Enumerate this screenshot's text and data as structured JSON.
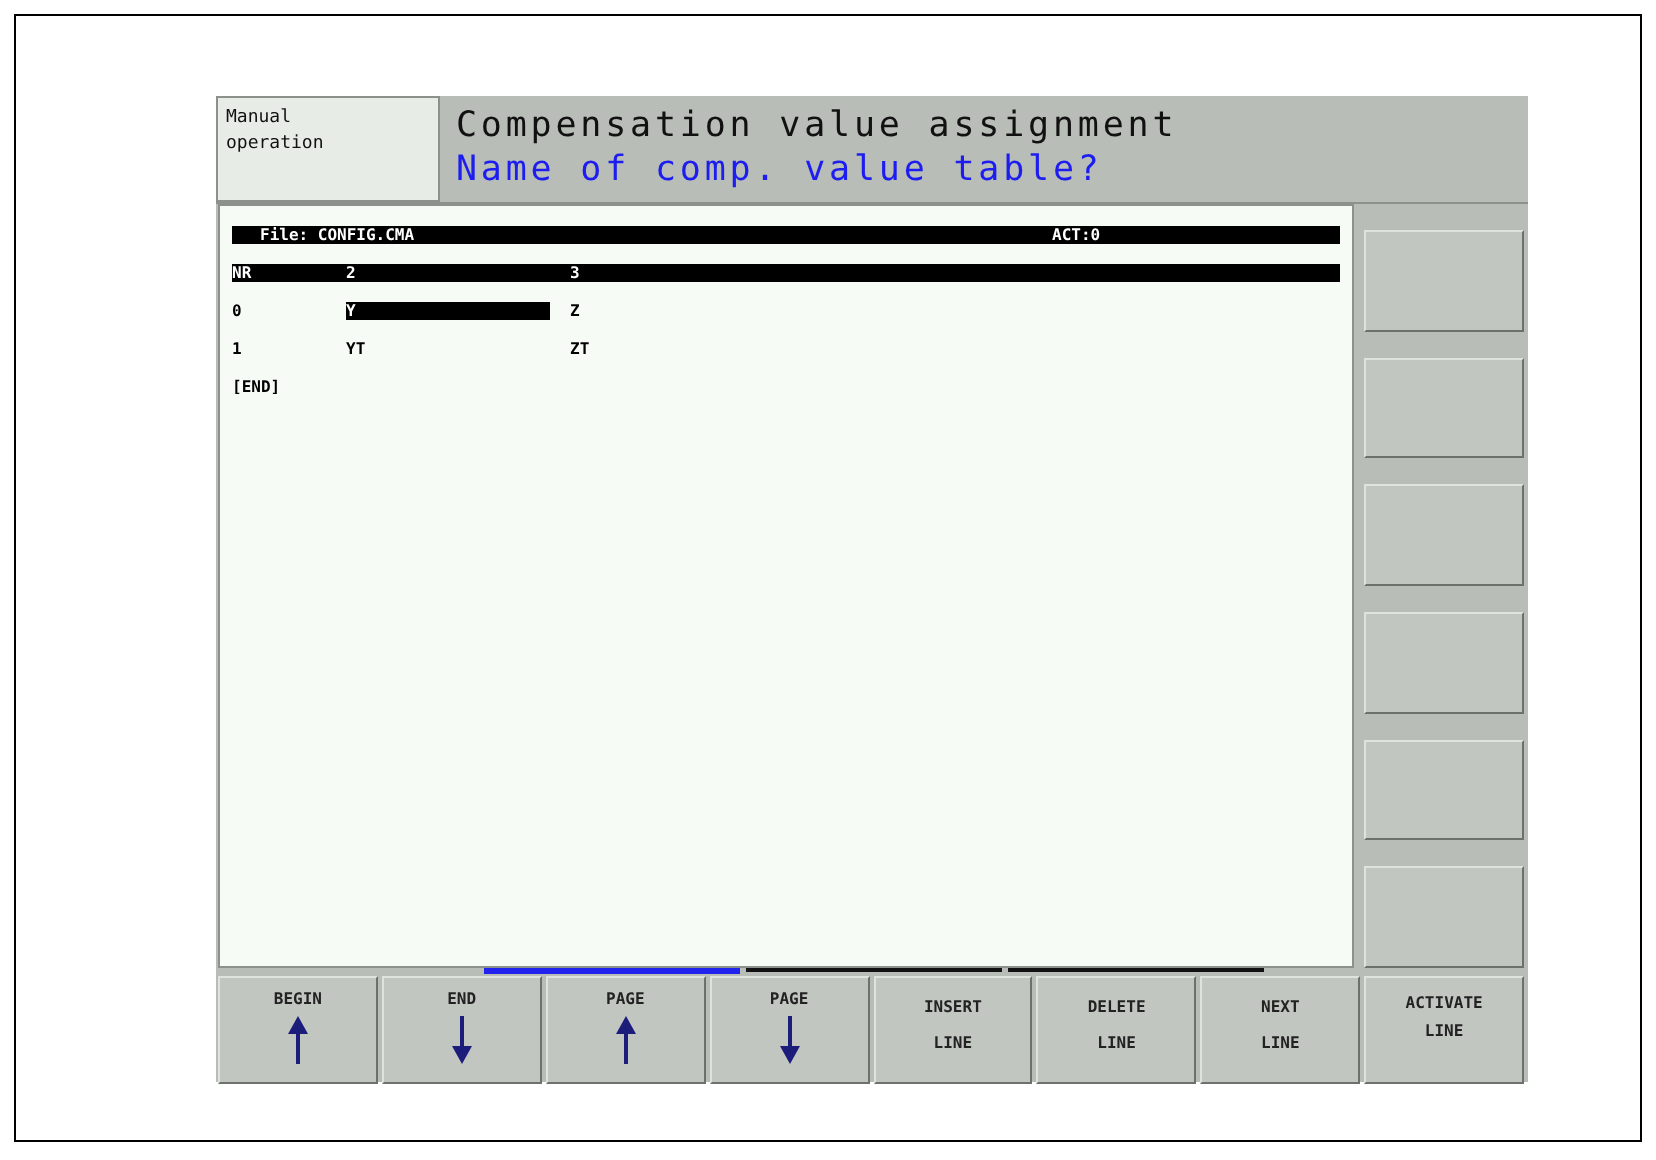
{
  "mode": {
    "label": "Manual\noperation"
  },
  "header": {
    "title": "Compensation value assignment",
    "prompt": "Name of comp. value table?"
  },
  "table": {
    "file": "File: CONFIG.CMA",
    "act": "ACT:0",
    "columns": [
      "NR",
      "2",
      "3"
    ],
    "rows": [
      {
        "cells": [
          {
            "text": "0",
            "selected": false
          },
          {
            "text": "Y",
            "selected": true
          },
          {
            "text": "Z",
            "selected": false
          }
        ]
      },
      {
        "cells": [
          {
            "text": "1",
            "selected": false
          },
          {
            "text": "YT",
            "selected": false
          },
          {
            "text": "ZT",
            "selected": false
          }
        ]
      }
    ],
    "end_marker": "[END]"
  },
  "softkey_levels": [
    {
      "selected": true
    },
    {
      "selected": false
    },
    {
      "selected": false
    }
  ],
  "softkeys": [
    {
      "label": "BEGIN",
      "kind": "up"
    },
    {
      "label": "END",
      "kind": "down"
    },
    {
      "label": "PAGE",
      "kind": "up"
    },
    {
      "label": "PAGE",
      "kind": "down"
    },
    {
      "label": "INSERT\nLINE",
      "kind": "text"
    },
    {
      "label": "DELETE\nLINE",
      "kind": "text"
    },
    {
      "label": "NEXT\nLINE",
      "kind": "text"
    },
    {
      "label": "ACTIVATE\nLINE",
      "kind": "text"
    }
  ]
}
